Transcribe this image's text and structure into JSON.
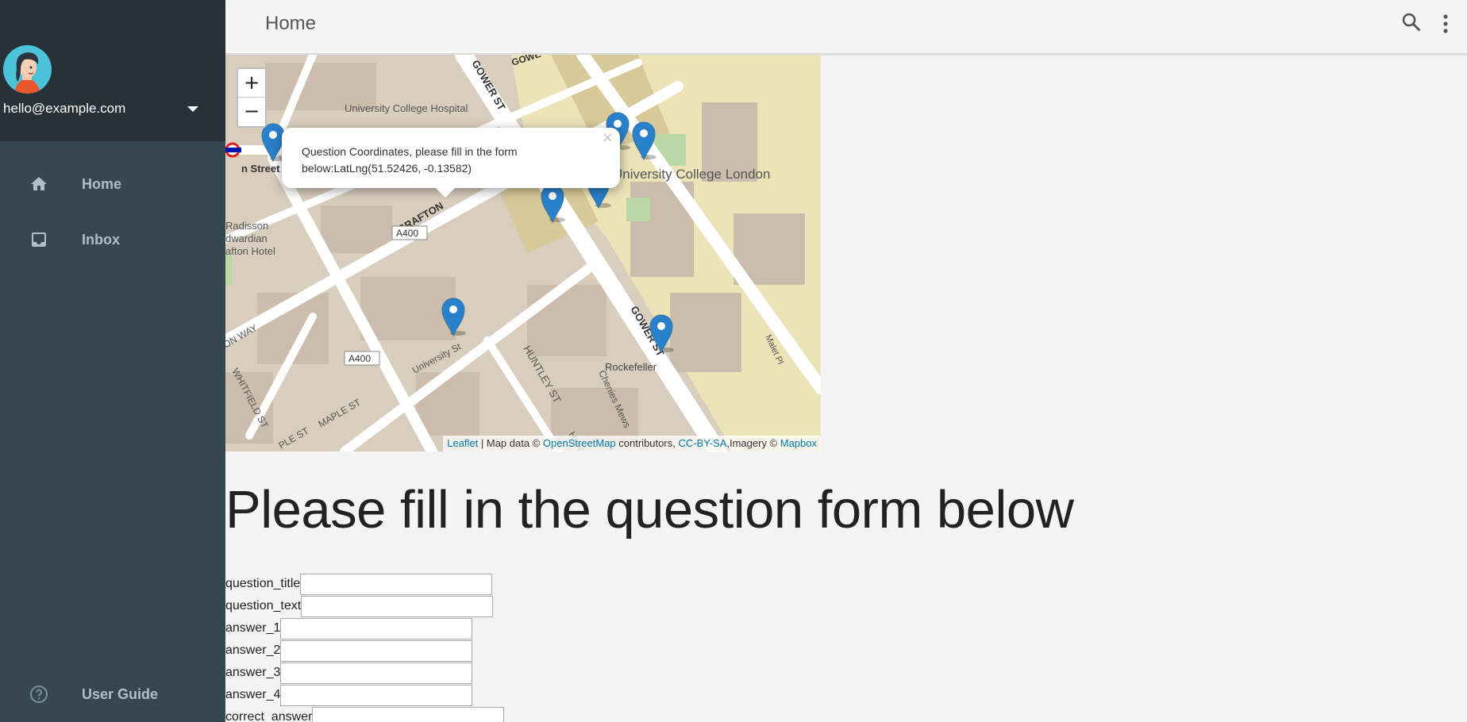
{
  "sidebar": {
    "account": {
      "email": "hello@example.com"
    },
    "items": [
      {
        "label": "Home",
        "icon": "home-icon"
      },
      {
        "label": "Inbox",
        "icon": "inbox-icon"
      }
    ],
    "footer_item": {
      "label": "User Guide",
      "icon": "help-icon"
    }
  },
  "header": {
    "title": "Home"
  },
  "map": {
    "zoom_in": "+",
    "zoom_out": "−",
    "labels": {
      "gower_st_top": "GOWER ST",
      "ucl_hospital": "University College Hospital",
      "ucl": "University College London",
      "street": "n Street",
      "grafton": "GRAFTON",
      "a400_top": "A400",
      "a400_bottom": "A400",
      "radisson": "Radisson",
      "edwardian": "dwardian",
      "grafton_hotel": "afton Hotel",
      "university_st": "University St",
      "huntley_st": "HUNTLEY ST",
      "gower_st_bottom": "GOWER ST",
      "rockefeller": "Rockefeller",
      "chenies_mews": "Chenies Mews",
      "malet_pl": "Malet Pl",
      "whitfield_st": "WHITFIELD ST",
      "maple_st": "MAPLE ST",
      "ple_st": "PLE ST",
      "on_way": "ON WAY",
      "gowe": "GOWE",
      "hun": "HUN"
    },
    "popup": {
      "text": "Question Coordinates, please fill in the form below:LatLng(51.52426, -0.13582)",
      "close": "×"
    },
    "attribution": {
      "leaflet": "Leaflet",
      "sep1": " | Map data © ",
      "osm": "OpenStreetMap",
      "contributors": " contributors, ",
      "ccbysa": "CC-BY-SA",
      "imagery": ",Imagery © ",
      "mapbox": "Mapbox"
    }
  },
  "form": {
    "heading": "Please fill in the question form below",
    "fields": [
      {
        "label": "question_title",
        "value": ""
      },
      {
        "label": "question_text",
        "value": ""
      },
      {
        "label": "answer_1",
        "value": ""
      },
      {
        "label": "answer_2",
        "value": ""
      },
      {
        "label": "answer_3",
        "value": ""
      },
      {
        "label": "answer_4",
        "value": ""
      },
      {
        "label": "correct_answer",
        "value": ""
      }
    ]
  },
  "colors": {
    "sidebar_bg": "#37474f",
    "sidebar_header_bg": "#263238",
    "marker_blue": "#2a81cb",
    "link_blue": "#0078a8"
  }
}
